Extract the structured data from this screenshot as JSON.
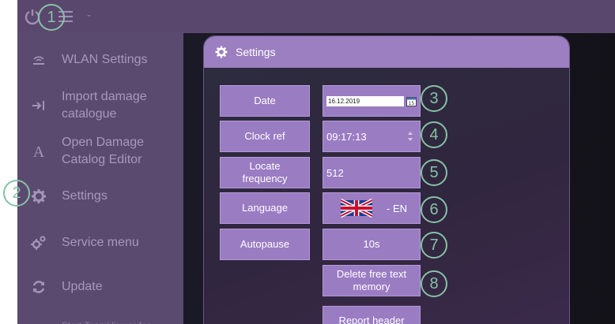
{
  "topbar": {
    "title": "-"
  },
  "sidebar": {
    "items": [
      {
        "label": "WLAN Settings",
        "icon": "wlan-icon"
      },
      {
        "label": "Import damage\ncatalogue",
        "icon": "import-arrow-icon"
      },
      {
        "label": "Open Damage\nCatalog Editor",
        "icon": "letter-a-icon"
      },
      {
        "label": "Settings",
        "icon": "gear-icon"
      },
      {
        "label": "Service menu",
        "icon": "gears-icon"
      },
      {
        "label": "Update",
        "icon": "refresh-icon"
      },
      {
        "label": "Start TeamViewer for",
        "icon": ""
      }
    ]
  },
  "dialog": {
    "title": "Settings",
    "rows": {
      "date": {
        "label": "Date",
        "value": "16.12.2019"
      },
      "clock": {
        "label": "Clock ref",
        "value": "09:17:13"
      },
      "frequency": {
        "label": "Locate\nfrequency",
        "value": "512"
      },
      "language": {
        "label": "Language",
        "value": "- EN"
      },
      "autopause": {
        "label": "Autopause",
        "value": "10s"
      },
      "delete_memory": {
        "label": "Delete free text\nmemory"
      },
      "report_header": {
        "label": "Report header"
      }
    }
  },
  "callouts": [
    "1",
    "2",
    "3",
    "4",
    "5",
    "6",
    "7",
    "8"
  ],
  "colors": {
    "accent": "#9a7cc3",
    "callout": "#86c2a4",
    "sidebar_bg": "#5b4a70"
  }
}
